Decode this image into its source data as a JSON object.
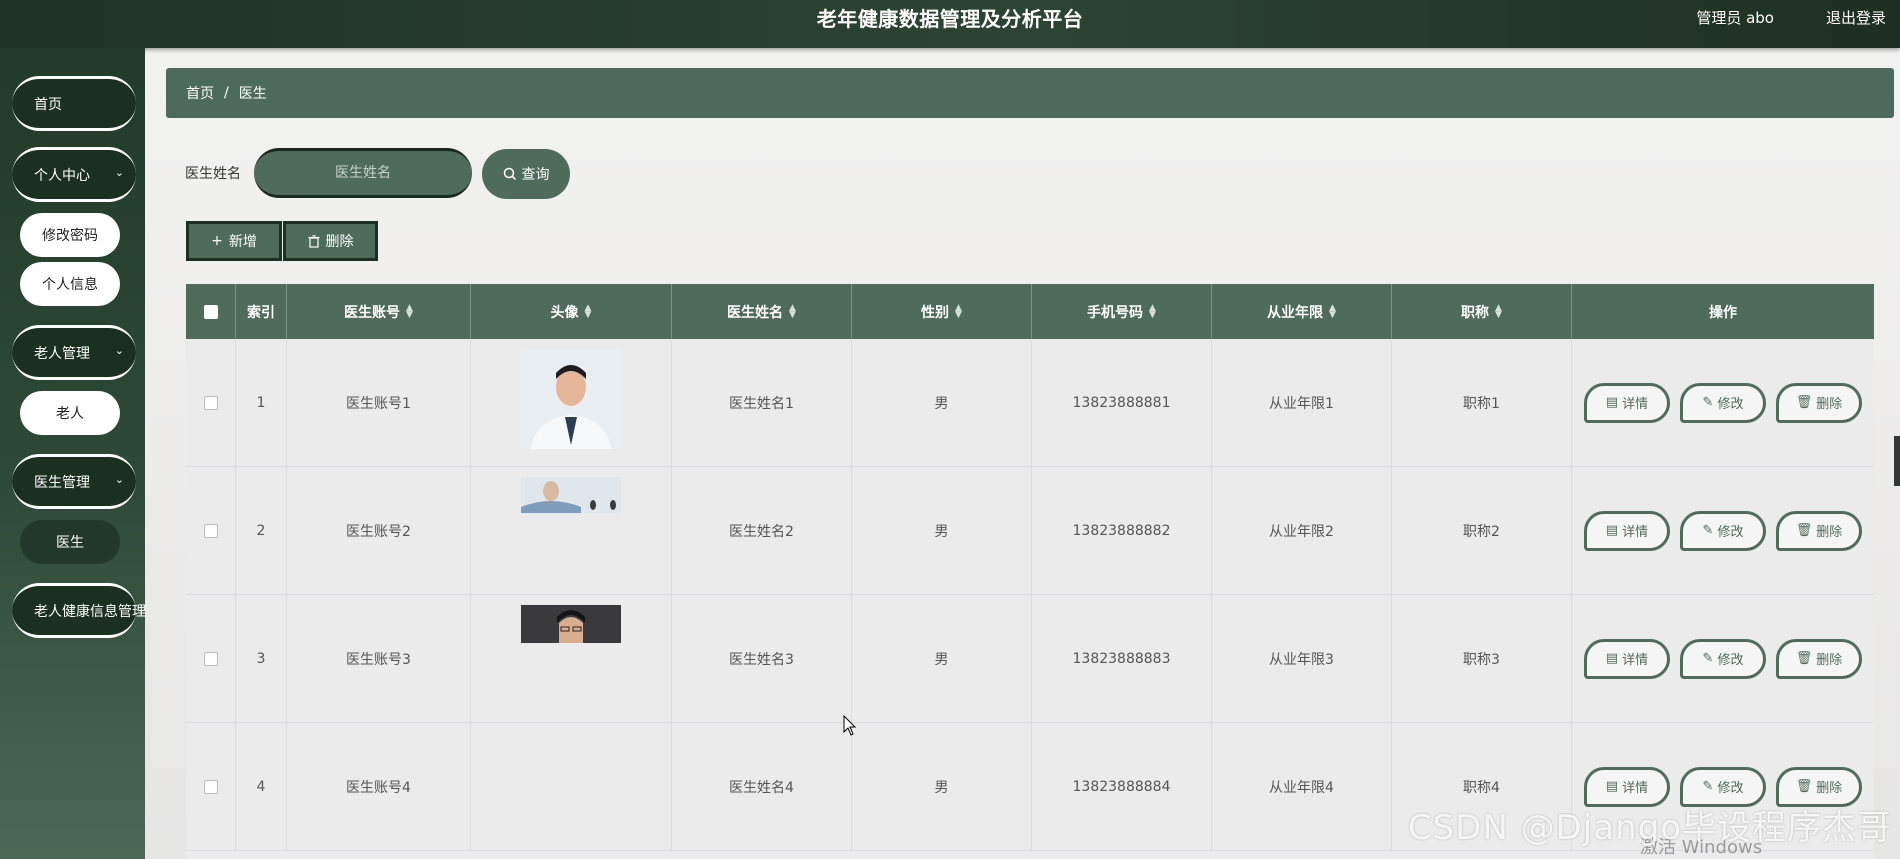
{
  "header": {
    "title": "老年健康数据管理及分析平台",
    "admin": "管理员 abo",
    "logout": "退出登录"
  },
  "sidebar": {
    "home": "首页",
    "personal": "个人中心",
    "personal_items": [
      "修改密码",
      "个人信息"
    ],
    "elder_mgmt": "老人管理",
    "elder_items": [
      "老人"
    ],
    "doctor_mgmt": "医生管理",
    "doctor_items": [
      "医生"
    ],
    "health_mgmt": "老人健康信息管理"
  },
  "breadcrumb": {
    "home": "首页",
    "sep": "/",
    "current": "医生"
  },
  "search": {
    "label": "医生姓名",
    "placeholder": "医生姓名",
    "button": "查询"
  },
  "actions": {
    "add": "新增",
    "delete": "删除"
  },
  "table": {
    "columns": [
      "索引",
      "医生账号",
      "头像",
      "医生姓名",
      "性别",
      "手机号码",
      "从业年限",
      "职称",
      "操作"
    ],
    "rows": [
      {
        "index": "1",
        "account": "医生账号1",
        "name": "医生姓名1",
        "gender": "男",
        "phone": "13823888881",
        "years": "从业年限1",
        "title": "职称1"
      },
      {
        "index": "2",
        "account": "医生账号2",
        "name": "医生姓名2",
        "gender": "男",
        "phone": "13823888882",
        "years": "从业年限2",
        "title": "职称2"
      },
      {
        "index": "3",
        "account": "医生账号3",
        "name": "医生姓名3",
        "gender": "男",
        "phone": "13823888883",
        "years": "从业年限3",
        "title": "职称3"
      },
      {
        "index": "4",
        "account": "医生账号4",
        "name": "医生姓名4",
        "gender": "男",
        "phone": "13823888884",
        "years": "从业年限4",
        "title": "职称4"
      }
    ],
    "op_labels": {
      "detail": "详情",
      "edit": "修改",
      "delete": "删除"
    }
  },
  "watermark": "CSDN @Django毕设程序杰哥",
  "windows_mark": "激活 Windows"
}
